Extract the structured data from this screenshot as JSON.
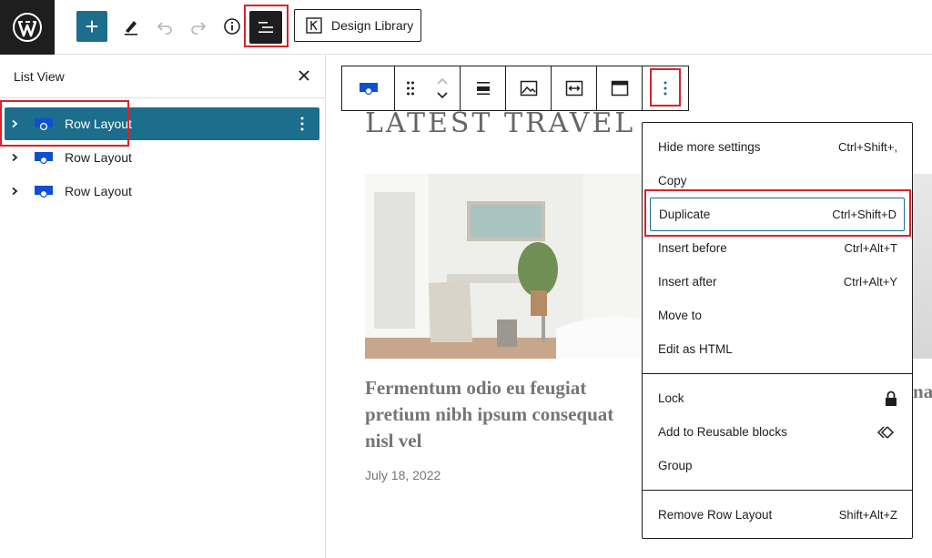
{
  "toolbar": {
    "add_label": "+",
    "design_library_label": "Design Library"
  },
  "sidebar": {
    "title": "List View",
    "items": [
      {
        "label": "Row Layout"
      },
      {
        "label": "Row Layout"
      },
      {
        "label": "Row Layout"
      }
    ]
  },
  "content": {
    "heading": "LATEST TRAVEL",
    "post_title": "Fermentum odio eu feugiat pretium nibh ipsum consequat nisl vel",
    "post_date": "July 18, 2022",
    "peek_text": "na"
  },
  "menu": {
    "groups": [
      [
        {
          "label": "Hide more settings",
          "shortcut": "Ctrl+Shift+,"
        },
        {
          "label": "Copy",
          "shortcut": ""
        },
        {
          "label": "Duplicate",
          "shortcut": "Ctrl+Shift+D"
        },
        {
          "label": "Insert before",
          "shortcut": "Ctrl+Alt+T"
        },
        {
          "label": "Insert after",
          "shortcut": "Ctrl+Alt+Y"
        },
        {
          "label": "Move to",
          "shortcut": ""
        },
        {
          "label": "Edit as HTML",
          "shortcut": ""
        }
      ],
      [
        {
          "label": "Lock",
          "icon": "lock-icon"
        },
        {
          "label": "Add to Reusable blocks",
          "icon": "reusable-block-icon"
        },
        {
          "label": "Group",
          "icon": ""
        }
      ],
      [
        {
          "label": "Remove Row Layout",
          "shortcut": "Shift+Alt+Z"
        }
      ]
    ]
  },
  "colors": {
    "accent": "#1d6d8d",
    "highlight_box": "#d9222a",
    "dark": "#1e1e1e"
  }
}
